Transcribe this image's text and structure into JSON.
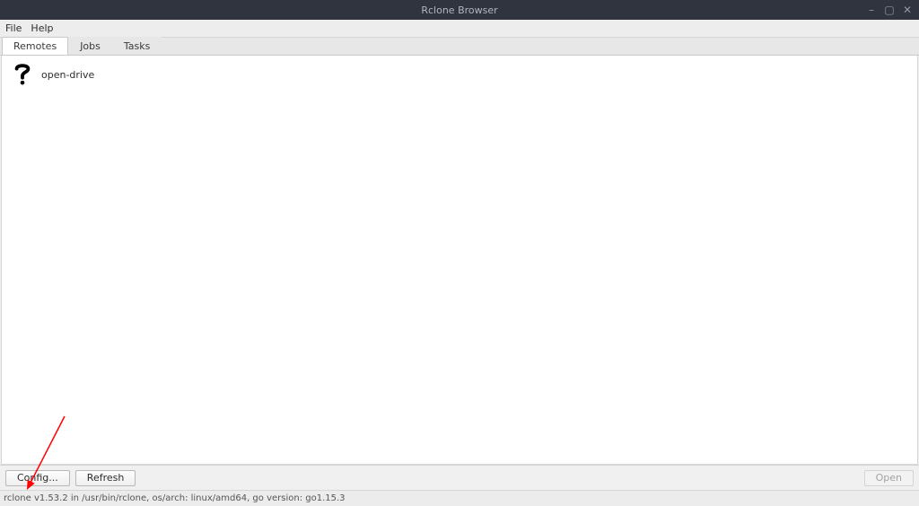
{
  "window": {
    "title": "Rclone Browser"
  },
  "menubar": {
    "file": "File",
    "help": "Help"
  },
  "tabs": {
    "remotes": "Remotes",
    "jobs": "Jobs",
    "tasks": "Tasks"
  },
  "remotes": {
    "items": [
      {
        "label": "open-drive"
      }
    ]
  },
  "buttons": {
    "config": "Config...",
    "refresh": "Refresh",
    "open": "Open"
  },
  "statusbar": {
    "text": "rclone v1.53.2 in /usr/bin/rclone, os/arch: linux/amd64, go version: go1.15.3"
  }
}
